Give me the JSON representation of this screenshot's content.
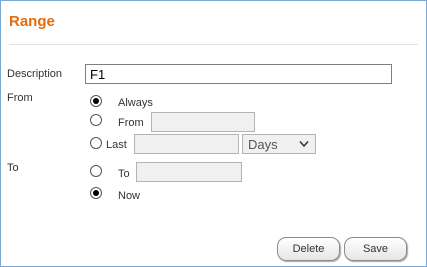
{
  "panel": {
    "title": "Range"
  },
  "description": {
    "label": "Description",
    "value": "F1"
  },
  "from": {
    "label": "From",
    "options": [
      {
        "label": "Always",
        "checked": true
      },
      {
        "label": "From",
        "checked": false
      },
      {
        "label": "Last",
        "checked": false
      }
    ],
    "from_value": "",
    "last_value": "",
    "last_unit": "Days"
  },
  "to": {
    "label": "To",
    "options": [
      {
        "label": "To",
        "checked": false
      },
      {
        "label": "Now",
        "checked": true
      }
    ],
    "to_value": ""
  },
  "buttons": {
    "delete": "Delete",
    "save": "Save"
  },
  "colors": {
    "title": "#e46c0a",
    "border": "#7aa7d6"
  }
}
